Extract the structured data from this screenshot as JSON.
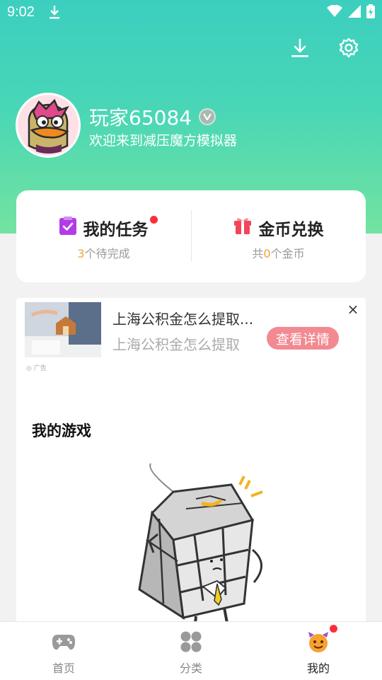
{
  "status_bar": {
    "time": "9:02"
  },
  "profile": {
    "name": "玩家65084",
    "welcome": "欢迎来到减压魔方模拟器"
  },
  "stats": {
    "tasks": {
      "label": "我的任务",
      "count": "3",
      "count_suffix": "个待完成"
    },
    "coins": {
      "label": "金币兑换",
      "prefix": "共",
      "count": "0",
      "count_suffix": "个金币"
    }
  },
  "ad": {
    "title": "上海公积金怎么提取...",
    "description": "上海公积金怎么提取",
    "button_label": "查看详情",
    "close": "×",
    "mark": "广告"
  },
  "my_games": {
    "title": "我的游戏"
  },
  "tabs": [
    {
      "label": "首页",
      "icon": "gamepad-icon"
    },
    {
      "label": "分类",
      "icon": "grid-icon"
    },
    {
      "label": "我的",
      "icon": "devil-face-icon"
    }
  ],
  "colors": {
    "hero_top": "#3ccfbf",
    "hero_bottom": "#73e3a0",
    "badge_red": "#ff2d3c",
    "count_orange": "#f4a23a",
    "ad_button": "#f28a91",
    "task_purple": "#b23ce8",
    "coin_red": "#f2455a"
  }
}
